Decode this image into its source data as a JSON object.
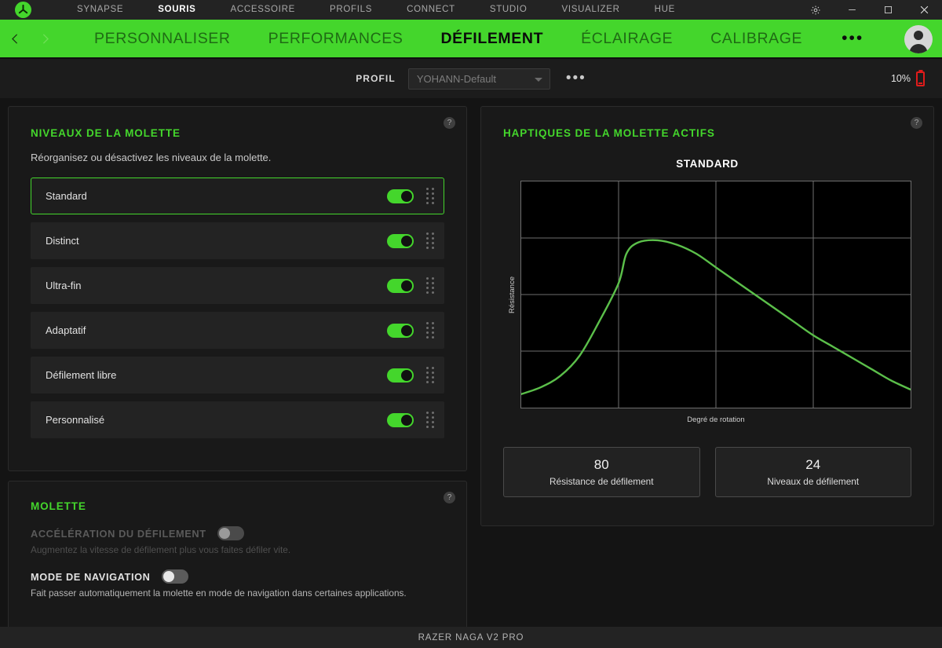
{
  "titlebar": {
    "logo_icon": "razer-logo-icon",
    "tabs": [
      {
        "label": "SYNAPSE",
        "active": false
      },
      {
        "label": "SOURIS",
        "active": true
      },
      {
        "label": "ACCESSOIRE",
        "active": false
      },
      {
        "label": "PROFILS",
        "active": false
      },
      {
        "label": "CONNECT",
        "active": false
      },
      {
        "label": "STUDIO",
        "active": false
      },
      {
        "label": "VISUALIZER",
        "active": false
      },
      {
        "label": "HUE",
        "active": false
      }
    ],
    "window_controls": [
      "gear-icon",
      "minimize-icon",
      "maximize-icon",
      "close-icon"
    ]
  },
  "navbar": {
    "back_icon": "chevron-left-icon",
    "forward_icon": "chevron-right-icon",
    "tabs": [
      {
        "label": "PERSONNALISER",
        "active": false
      },
      {
        "label": "PERFORMANCES",
        "active": false
      },
      {
        "label": "DÉFILEMENT",
        "active": true
      },
      {
        "label": "ÉCLAIRAGE",
        "active": false
      },
      {
        "label": "CALIBRAGE",
        "active": false
      }
    ],
    "more_label": "•••",
    "avatar_icon": "user-avatar-icon",
    "accent_color": "#44d62c"
  },
  "profilebar": {
    "label": "PROFIL",
    "selected_profile": "YOHANN-Default",
    "more_label": "•••",
    "battery_percent": "10%",
    "battery_color": "#e01b1b"
  },
  "levels_card": {
    "title": "NIVEAUX DE LA MOLETTE",
    "subtitle": "Réorganisez ou désactivez les niveaux de la molette.",
    "help_label": "?",
    "items": [
      {
        "name": "Standard",
        "enabled": true,
        "selected": true
      },
      {
        "name": "Distinct",
        "enabled": true,
        "selected": false
      },
      {
        "name": "Ultra-fin",
        "enabled": true,
        "selected": false
      },
      {
        "name": "Adaptatif",
        "enabled": true,
        "selected": false
      },
      {
        "name": "Défilement libre",
        "enabled": true,
        "selected": false
      },
      {
        "name": "Personnalisé",
        "enabled": true,
        "selected": false
      }
    ]
  },
  "molette_card": {
    "title": "MOLETTE",
    "help_label": "?",
    "acceleration": {
      "label": "ACCÉLÉRATION DU DÉFILEMENT",
      "description": "Augmentez la vitesse de défilement plus vous faites défiler vite.",
      "enabled": false,
      "disabled": true
    },
    "navigation": {
      "label": "MODE DE NAVIGATION",
      "description": "Fait passer automatiquement la molette en mode de navigation dans certaines applications.",
      "enabled": false,
      "disabled": false
    }
  },
  "haptics_card": {
    "title": "HAPTIQUES DE LA MOLETTE ACTIFS",
    "help_label": "?",
    "stats": [
      {
        "value": "80",
        "label": "Résistance de défilement"
      },
      {
        "value": "24",
        "label": "Niveaux de défilement"
      }
    ]
  },
  "chart_data": {
    "type": "line",
    "title": "STANDARD",
    "xlabel": "Degré de rotation",
    "ylabel": "Résistance",
    "xlim": [
      0,
      100
    ],
    "ylim": [
      0,
      100
    ],
    "grid": true,
    "grid_cols": 4,
    "grid_rows": 4,
    "legend": "none",
    "line_color": "#5bbf4a",
    "plot_bg": "#000000",
    "x": [
      0,
      5,
      10,
      15,
      20,
      25,
      27,
      30,
      35,
      40,
      45,
      50,
      55,
      60,
      65,
      70,
      75,
      80,
      85,
      90,
      95,
      100
    ],
    "y": [
      6,
      9,
      14,
      23,
      38,
      55,
      68,
      73,
      74,
      72,
      68,
      62,
      56,
      50,
      44,
      38,
      32,
      27,
      22,
      17,
      12,
      8
    ],
    "series": [
      {
        "name": "Standard",
        "values": [
          6,
          9,
          14,
          23,
          38,
          55,
          68,
          73,
          74,
          72,
          68,
          62,
          56,
          50,
          44,
          38,
          32,
          27,
          22,
          17,
          12,
          8
        ]
      }
    ]
  },
  "footer": {
    "device_name": "RAZER NAGA V2 PRO"
  }
}
